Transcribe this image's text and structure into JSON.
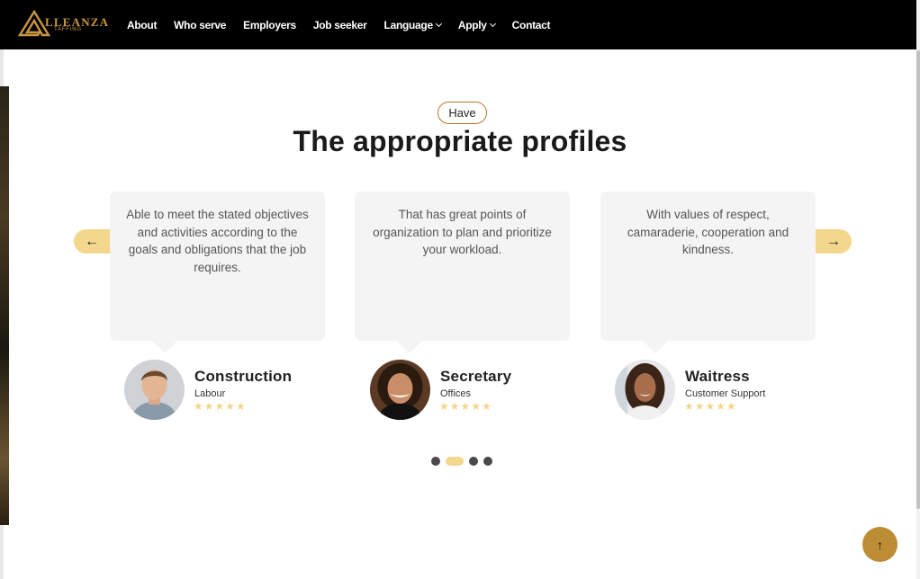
{
  "brand": {
    "name": "LLEANZA",
    "tagline": "TAFFING"
  },
  "nav": {
    "items": [
      {
        "label": "About",
        "dropdown": false
      },
      {
        "label": "Who serve",
        "dropdown": false
      },
      {
        "label": "Employers",
        "dropdown": false
      },
      {
        "label": "Job seeker",
        "dropdown": false
      },
      {
        "label": "Language",
        "dropdown": true
      },
      {
        "label": "Apply",
        "dropdown": true
      },
      {
        "label": "Contact",
        "dropdown": false
      }
    ]
  },
  "section": {
    "badge": "Have",
    "title": "The appropriate profiles"
  },
  "carousel": {
    "prev_icon": "arrow-left-icon",
    "next_icon": "arrow-right-icon",
    "prev_glyph": "←",
    "next_glyph": "→",
    "cards": [
      {
        "text": "Able to meet the stated objectives and activities according to the goals and obligations that the job requires.",
        "name": "Construction",
        "role": "Labour",
        "stars": "★★★★★"
      },
      {
        "text": "That has great points of organization to plan and prioritize your workload.",
        "name": "Secretary",
        "role": "Offices",
        "stars": "★★★★★"
      },
      {
        "text": "With values of respect, camaraderie, cooperation and kindness.",
        "name": "Waitress",
        "role": "Customer Support",
        "stars": "★★★★★"
      }
    ],
    "dots": {
      "count": 4,
      "active_index": 1
    }
  },
  "back_to_top": {
    "glyph": "↑",
    "icon": "arrow-up-icon"
  },
  "colors": {
    "accent": "#f2d78c",
    "gold": "#bd8d35",
    "navbar": "#000000"
  }
}
